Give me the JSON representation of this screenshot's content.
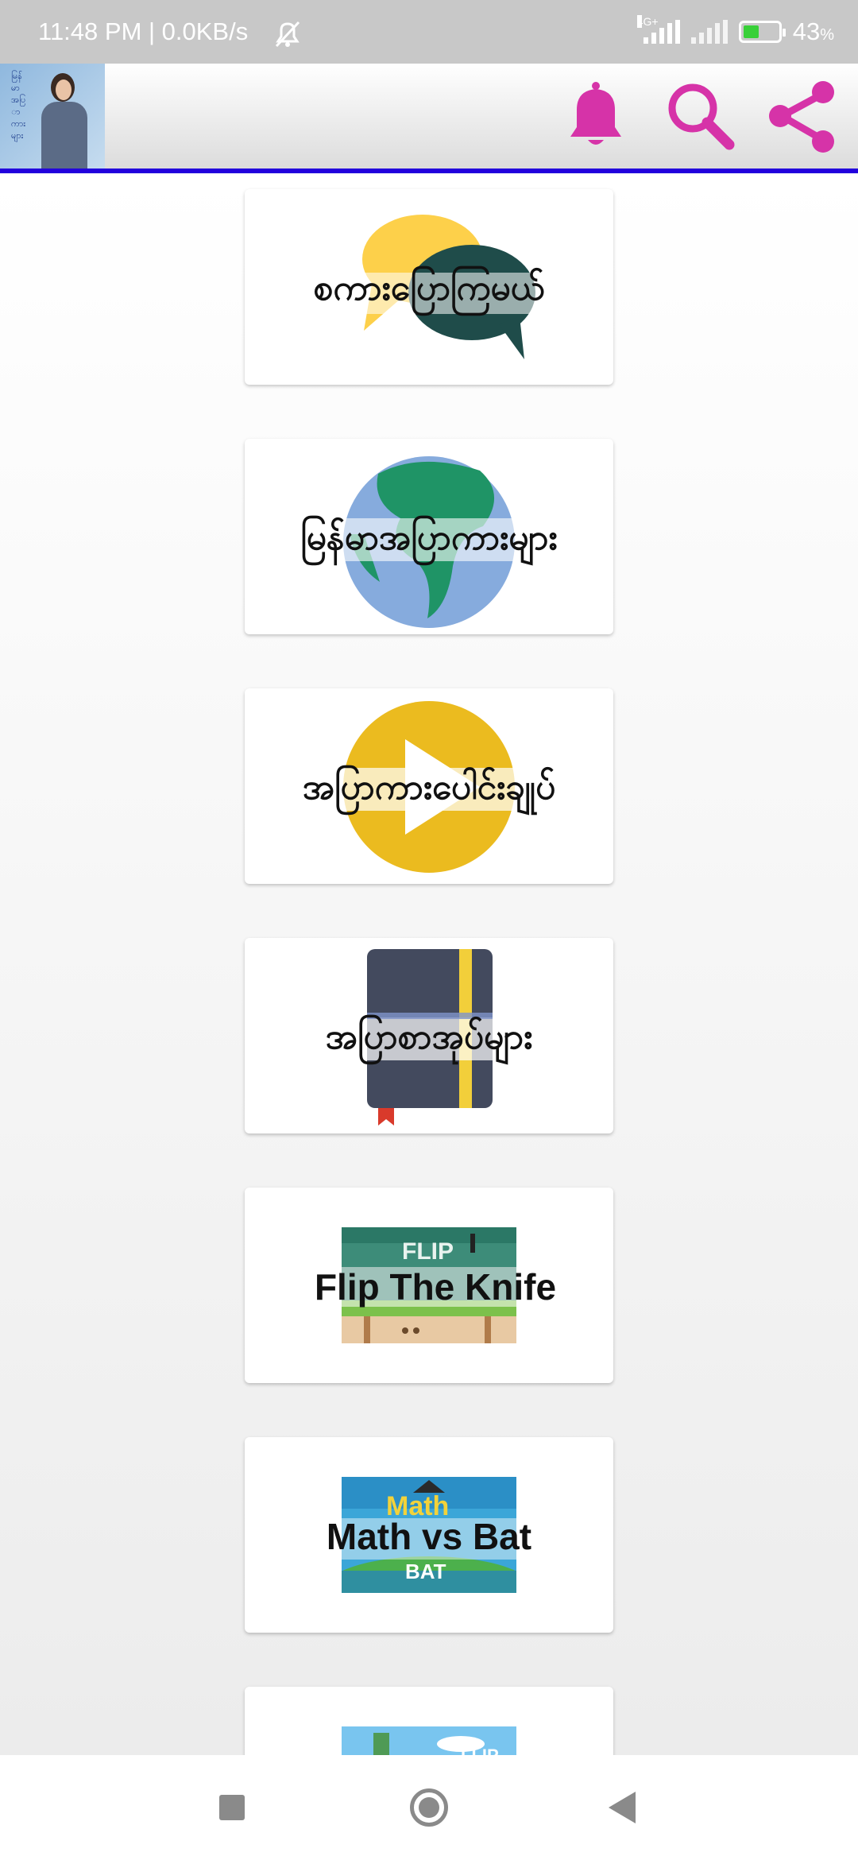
{
  "status_bar": {
    "time": "11:48 PM | 0.0KB/s",
    "network_tag": "4G+",
    "battery_percent": "43",
    "battery_suffix": "%"
  },
  "app_bar": {
    "logo_text": "မြန်မာအပြာကားများ",
    "icons": [
      "bell-icon",
      "search-icon",
      "share-icon"
    ],
    "accent_color": "#d633a8",
    "divider_color": "#2200dd"
  },
  "cards": [
    {
      "label": "စကားပြောကြမယ်",
      "art": "chat-bubbles-icon"
    },
    {
      "label": "မြန်မာအပြာကားများ",
      "art": "globe-icon"
    },
    {
      "label": "အပြာကားပေါင်းချုပ်",
      "art": "play-icon"
    },
    {
      "label": "အပြာစာအုပ်များ",
      "art": "book-icon"
    },
    {
      "label": "Flip The Knife",
      "art": "flip-game-thumbnail"
    },
    {
      "label": "Math vs Bat",
      "art": "math-game-thumbnail"
    },
    {
      "label": "",
      "art": "game-thumbnail"
    }
  ],
  "nav_bar": {
    "buttons": [
      "recents-button",
      "home-button",
      "back-button"
    ]
  }
}
